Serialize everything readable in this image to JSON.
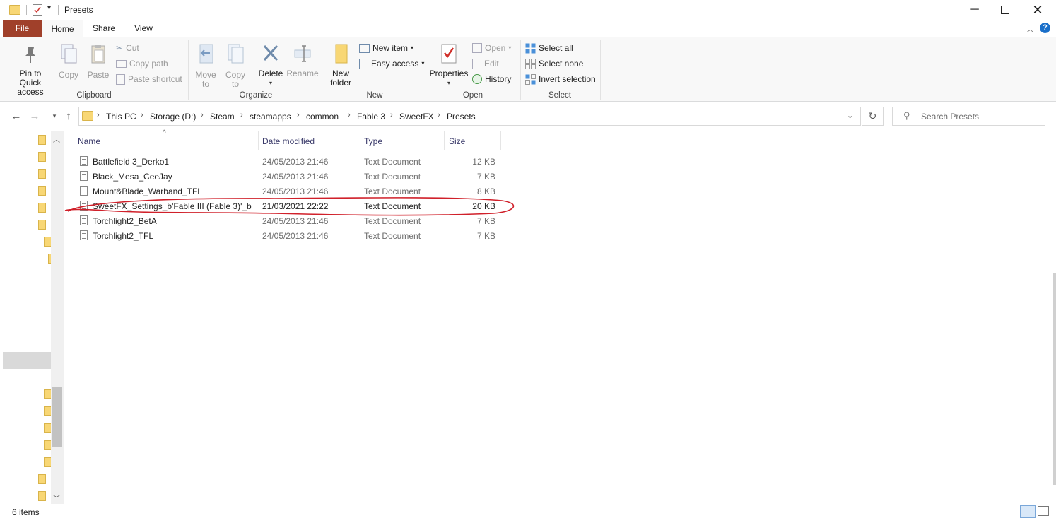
{
  "window": {
    "title": "Presets"
  },
  "tabs": {
    "file": "File",
    "home": "Home",
    "share": "Share",
    "view": "View"
  },
  "ribbon": {
    "clipboard": {
      "pin": "Pin to Quick access",
      "copy": "Copy",
      "paste": "Paste",
      "cut": "Cut",
      "copy_path": "Copy path",
      "paste_shortcut": "Paste shortcut",
      "label": "Clipboard"
    },
    "organize": {
      "move_to": "Move to",
      "copy_to": "Copy to",
      "delete": "Delete",
      "rename": "Rename",
      "label": "Organize"
    },
    "new": {
      "new_folder": "New folder",
      "new_item": "New item",
      "easy_access": "Easy access",
      "label": "New"
    },
    "open": {
      "properties": "Properties",
      "open": "Open",
      "edit": "Edit",
      "history": "History",
      "label": "Open"
    },
    "select": {
      "select_all": "Select all",
      "select_none": "Select none",
      "invert": "Invert selection",
      "label": "Select"
    }
  },
  "address": {
    "crumbs": [
      "This PC",
      "Storage (D:)",
      "Steam",
      "steamapps",
      "common",
      "Fable 3",
      "SweetFX",
      "Presets"
    ],
    "search_placeholder": "Search Presets"
  },
  "columns": {
    "name": "Name",
    "date": "Date modified",
    "type": "Type",
    "size": "Size"
  },
  "files": [
    {
      "name": "Battlefield 3_Derko1",
      "date": "24/05/2013 21:46",
      "type": "Text Document",
      "size": "12 KB"
    },
    {
      "name": "Black_Mesa_CeeJay",
      "date": "24/05/2013 21:46",
      "type": "Text Document",
      "size": "7 KB"
    },
    {
      "name": "Mount&Blade_Warband_TFL",
      "date": "24/05/2013 21:46",
      "type": "Text Document",
      "size": "8 KB"
    },
    {
      "name": "SweetFX_Settings_b'Fable III (Fable 3)'_b",
      "date": "21/03/2021 22:22",
      "type": "Text Document",
      "size": "20 KB"
    },
    {
      "name": "Torchlight2_BetA",
      "date": "24/05/2013 21:46",
      "type": "Text Document",
      "size": "7 KB"
    },
    {
      "name": "Torchlight2_TFL",
      "date": "24/05/2013 21:46",
      "type": "Text Document",
      "size": "7 KB"
    }
  ],
  "status": {
    "items": "6 items"
  },
  "colors": {
    "file_tab": "#a0402a",
    "annotation": "#d0202a",
    "folder": "#f8d775"
  }
}
